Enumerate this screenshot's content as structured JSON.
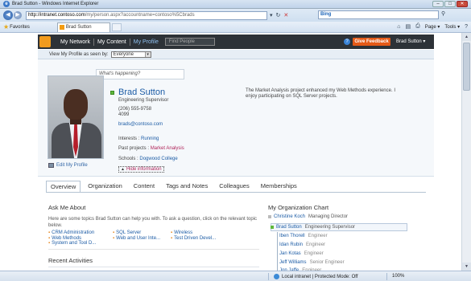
{
  "window": {
    "title": "Brad Sutton - Windows Internet Explorer",
    "buttons": [
      "–",
      "□",
      "✕"
    ]
  },
  "address": {
    "url_host": "http://intranet.contoso.com",
    "url_rest": "/my/person.aspx?accountname=contoso%5Cbrads",
    "search_engine": "Bing"
  },
  "favorites": {
    "label": "Favorites",
    "tab_title": "Brad Sutton"
  },
  "commands": {
    "page": "Page ▾",
    "tools": "Tools ▾"
  },
  "sp_nav": {
    "my_network": "My Network",
    "my_content": "My Content",
    "my_profile": "My Profile",
    "find_placeholder": "Find People",
    "give_feedback": "Give Feedback",
    "user": "Brad Sutton ▾"
  },
  "view_as": {
    "label": "View My Profile as seen by:",
    "value": "Everyone"
  },
  "status_prompt": "What's happening?",
  "profile": {
    "name": "Brad Sutton",
    "title": "Engineering Supervisor",
    "phone": "(206) 555-9758",
    "ext": "4099",
    "email": "brads@contoso.com",
    "interests_label": "Interests :",
    "interests": "Running",
    "projects_label": "Past projects :",
    "projects": "Market Analysis",
    "schools_label": "Schools :",
    "schools": "Dogwood College",
    "hide_info": "Hide information",
    "edit": "Edit My Profile",
    "about": "The Market Analysis project enhanced my Web Methods experience. I enjoy participating on SQL Server projects."
  },
  "tabs": [
    "Overview",
    "Organization",
    "Content",
    "Tags and Notes",
    "Colleagues",
    "Memberships"
  ],
  "ask": {
    "heading": "Ask Me About",
    "desc": "Here are some topics Brad Sutton can help you with. To ask a question, click on the relevant topic below.",
    "topics": [
      "CRM Administration",
      "SQL Server",
      "Wireless",
      "Web Methods",
      "Web and User Inte...",
      "Test Driven Devel...",
      "System and Tool D...",
      "",
      ""
    ]
  },
  "recent": {
    "heading": "Recent Activities"
  },
  "org": {
    "heading": "My Organization Chart",
    "manager": {
      "name": "Christine Koch",
      "role": "Managing Director"
    },
    "me": {
      "name": "Brad Sutton",
      "role": "Engineering Supervisor"
    },
    "reports": [
      {
        "name": "Iben Thorell",
        "role": "Engineer"
      },
      {
        "name": "Idan Rubin",
        "role": "Engineer"
      },
      {
        "name": "Jan Kotas",
        "role": "Engineer"
      },
      {
        "name": "Jeff Williams",
        "role": "Senior Engineer"
      },
      {
        "name": "Jon Jaffe",
        "role": "Engineer"
      }
    ]
  },
  "statusbar": {
    "zone": "Local intranet | Protected Mode: Off",
    "zoom": "100%"
  }
}
